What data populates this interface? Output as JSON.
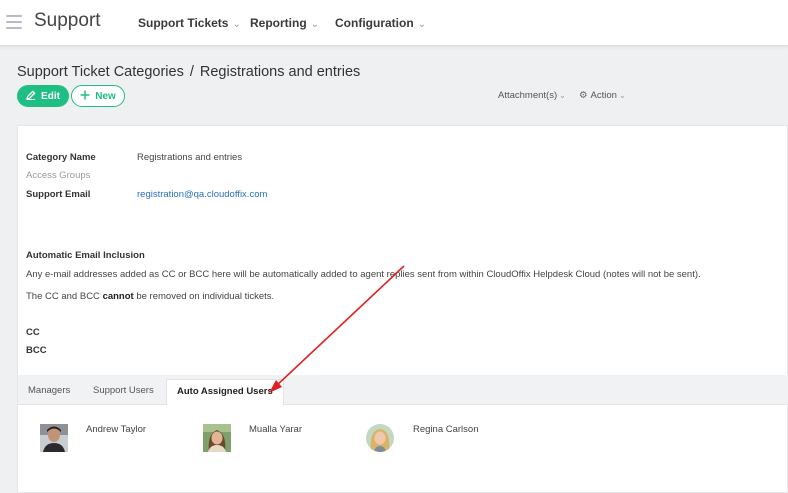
{
  "app": {
    "brand": "Support",
    "nav": [
      {
        "label": "Support Tickets"
      },
      {
        "label": "Reporting"
      },
      {
        "label": "Configuration"
      }
    ]
  },
  "header": {
    "breadcrumb_parent": "Support Ticket Categories",
    "breadcrumb_separator": "/",
    "breadcrumb_current": "Registrations and entries",
    "edit_label": "Edit",
    "new_label": "New",
    "attachments_label": "Attachment(s)",
    "action_label": "Action"
  },
  "details": {
    "category_name_label": "Category Name",
    "category_name_value": "Registrations and entries",
    "access_groups_label": "Access Groups",
    "support_email_label": "Support Email",
    "support_email_value": "registration@qa.cloudoffix.com"
  },
  "email_inclusion": {
    "heading": "Automatic Email Inclusion",
    "description": "Any e-mail addresses added as CC or BCC here will be automatically added to agent replies sent from within CloudOffix Helpdesk Cloud (notes will not be sent).",
    "note_prefix": "The CC and BCC ",
    "note_bold": "cannot",
    "note_suffix": " be removed on individual tickets.",
    "cc_label": "CC",
    "bcc_label": "BCC"
  },
  "tabs": [
    {
      "label": "Managers"
    },
    {
      "label": "Support Users"
    },
    {
      "label": "Auto Assigned Users"
    }
  ],
  "users": [
    {
      "name": "Andrew Taylor"
    },
    {
      "name": "Mualla Yarar"
    },
    {
      "name": "Regina Carlson"
    }
  ],
  "colors": {
    "accent": "#1fbf84",
    "link": "#2a6fbb",
    "annotation_arrow": "#e02020"
  },
  "icons": {
    "menu": "hamburger-icon",
    "edit": "pencil-icon",
    "new": "plus-icon",
    "action": "gear-icon"
  }
}
